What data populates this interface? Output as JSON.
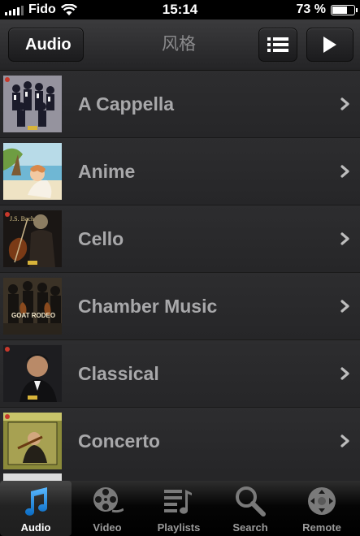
{
  "status": {
    "carrier": "Fido",
    "time": "15:14",
    "battery": "73 %",
    "battery_level": 0.73
  },
  "nav": {
    "back_label": "Audio",
    "title": "风格"
  },
  "genres": [
    {
      "label": "A Cappella"
    },
    {
      "label": "Anime"
    },
    {
      "label": "Cello"
    },
    {
      "label": "Chamber Music"
    },
    {
      "label": "Classical"
    },
    {
      "label": "Concerto"
    }
  ],
  "art_text": {
    "cello_cover": "J.S. Bach",
    "chamber_cover": "GOAT RODEO"
  },
  "tabs": [
    {
      "label": "Audio",
      "icon": "music-note-icon",
      "active": true
    },
    {
      "label": "Video",
      "icon": "film-reel-icon"
    },
    {
      "label": "Playlists",
      "icon": "playlist-icon"
    },
    {
      "label": "Search",
      "icon": "search-icon"
    },
    {
      "label": "Remote",
      "icon": "remote-control-icon"
    }
  ],
  "colors": {
    "accent_tab": "#1e8fe0",
    "row_text": "#a8a8aa",
    "background": "#2a2a2c"
  }
}
